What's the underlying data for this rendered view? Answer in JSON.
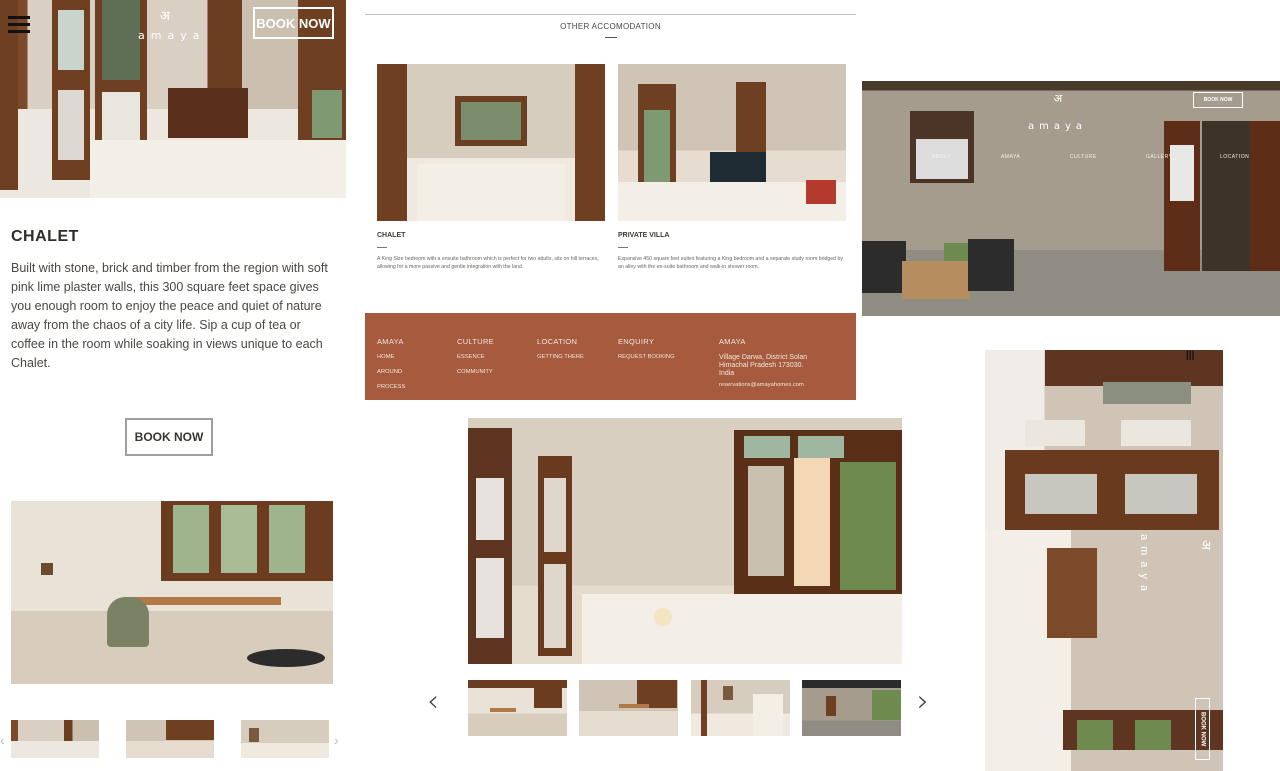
{
  "brand": {
    "logo_mark": "अ",
    "wordmark": "amaya"
  },
  "chalet_panel": {
    "book_now_top": "BOOK NOW",
    "title": "CHALET",
    "description": "Built with stone, brick and timber from the region with soft pink lime plaster walls, this 300 square feet space gives you enough room to enjoy the peace and quiet of nature away from the chaos of a city life. Sip a cup of tea or coffee in the room while soaking in views unique to each Chalet.",
    "book_now": "BOOK NOW"
  },
  "accommodation": {
    "heading": "OTHER ACCOMODATION",
    "cards": [
      {
        "title": "CHALET",
        "desc": "A King Size bedroom with a ensuite bathroom which is perfect for two adults, sits on hill terraces, allowing for a more passive and gentle integration with the land."
      },
      {
        "title": "PRIVATE VILLA",
        "desc": "Expansive 450 square feet suites featuring a King bedroom and a separate study room bridged by an alley with the en-suite bathroom and walk-in shower room."
      }
    ]
  },
  "footer": {
    "columns": [
      {
        "heading": "AMAYA",
        "links": [
          "HOME",
          "AROUND",
          "PROCESS"
        ]
      },
      {
        "heading": "CULTURE",
        "links": [
          "ESSENCE",
          "COMMUNITY"
        ]
      },
      {
        "heading": "LOCATION",
        "links": [
          "GETTING THERE"
        ]
      },
      {
        "heading": "ENQUIRY",
        "links": [
          "REQUEST BOOKING"
        ]
      }
    ],
    "contact": {
      "heading": "AMAYA",
      "address": "Village Darwa, District Solan Himachal Pradesh 173030. India",
      "email": "reservations@amayahomes.com"
    },
    "bg_color": "#a65a3e"
  },
  "exterior_nav": {
    "book_now": "BOOK NOW",
    "items": [
      "ABOUT",
      "AMAYA",
      "CULTURE",
      "GALLERY",
      "LOCATION"
    ]
  },
  "gallery": {
    "prev_icon": "‹",
    "next_icon": "›"
  },
  "vertical_panel": {
    "book_now": "BOOK NOW",
    "menu_icon": "|||"
  }
}
